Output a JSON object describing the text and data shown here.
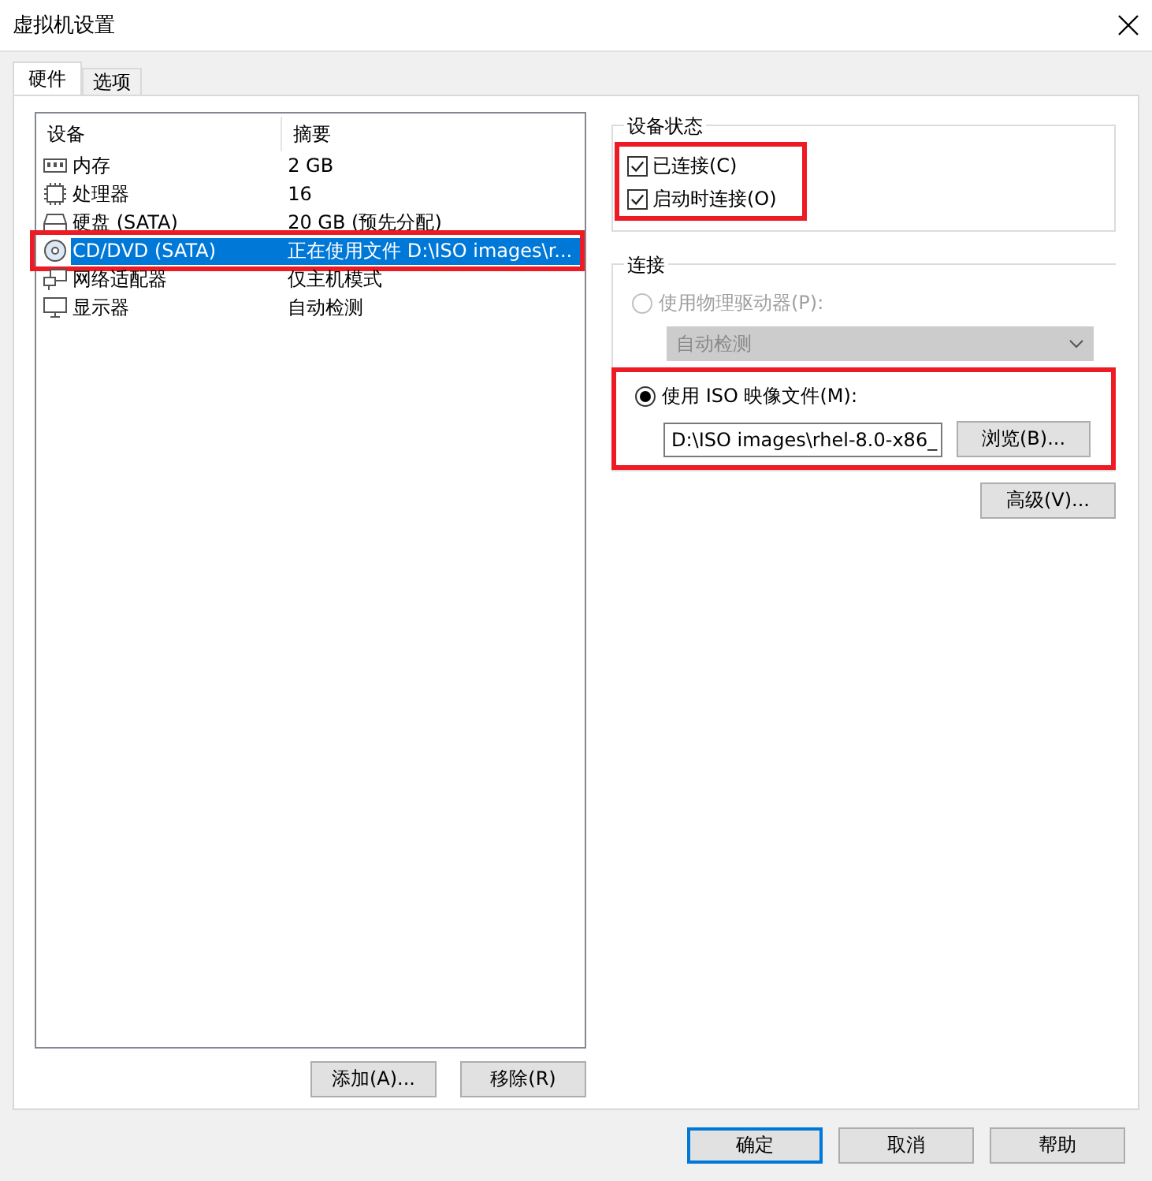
{
  "window": {
    "title": "虚拟机设置"
  },
  "tabs": [
    {
      "label": "硬件",
      "selected": true
    },
    {
      "label": "选项",
      "selected": false
    }
  ],
  "device_list": {
    "columns": [
      "设备",
      "摘要"
    ],
    "rows": [
      {
        "kind": "memory",
        "device": "内存",
        "summary": "2 GB",
        "selected": false,
        "highlighted": false
      },
      {
        "kind": "cpu",
        "device": "处理器",
        "summary": "16",
        "selected": false,
        "highlighted": false
      },
      {
        "kind": "disk",
        "device": "硬盘 (SATA)",
        "summary": "20 GB (预先分配)",
        "selected": false,
        "highlighted": false
      },
      {
        "kind": "cd",
        "device": "CD/DVD (SATA)",
        "summary": "正在使用文件 D:\\ISO images\\r...",
        "selected": true,
        "highlighted": true
      },
      {
        "kind": "network",
        "device": "网络适配器",
        "summary": "仅主机模式",
        "selected": false,
        "highlighted": false
      },
      {
        "kind": "display",
        "device": "显示器",
        "summary": "自动检测",
        "selected": false,
        "highlighted": false
      }
    ]
  },
  "list_buttons": [
    "添加(A)...",
    "移除(R)"
  ],
  "device_status": {
    "title": "设备状态",
    "highlighted": true,
    "options": [
      {
        "label": "已连接(C)",
        "checked": true
      },
      {
        "label": "启动时连接(O)",
        "checked": true
      }
    ]
  },
  "connection": {
    "title": "连接",
    "options": [
      {
        "kind": "physical",
        "label": "使用物理驱动器(P):",
        "selected": false,
        "disabled": true,
        "dropdown": "自动检测",
        "highlighted": false
      },
      {
        "kind": "iso",
        "label": "使用 ISO 映像文件(M):",
        "selected": true,
        "disabled": false,
        "path": "D:\\ISO images\\rhel-8.0-x86_",
        "button": "浏览(B)...",
        "highlighted": true
      }
    ]
  },
  "advanced_button": "高级(V)...",
  "dialog_buttons": [
    {
      "label": "确定",
      "default": true
    },
    {
      "label": "取消",
      "default": false
    },
    {
      "label": "帮助",
      "default": false
    }
  ]
}
